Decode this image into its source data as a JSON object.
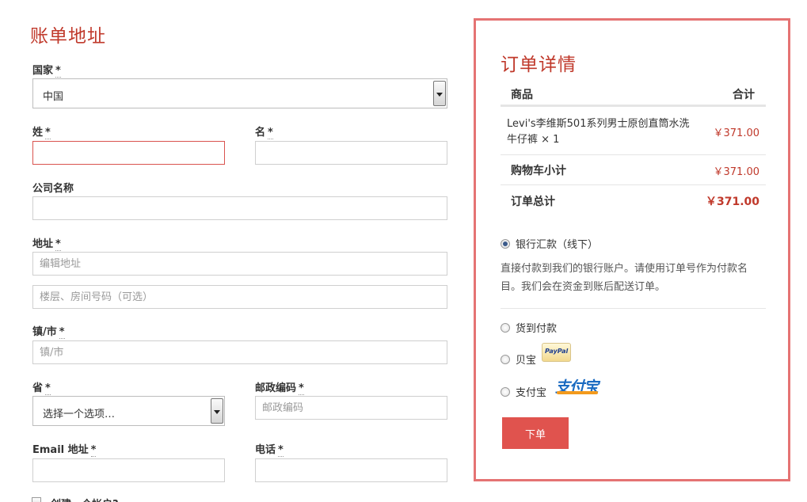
{
  "billing": {
    "title": "账单地址",
    "required_mark": "*",
    "country_label": "国家",
    "country_value": "中国",
    "last_name_label": "姓",
    "first_name_label": "名",
    "company_label": "公司名称",
    "address_label": "地址",
    "address_placeholder": "编辑地址",
    "address2_placeholder": "楼层、房间号码（可选）",
    "city_label": "镇/市",
    "city_placeholder": "镇/市",
    "state_label": "省",
    "state_value": "选择一个选项…",
    "postcode_label": "邮政编码",
    "postcode_placeholder": "邮政编码",
    "email_label": "Email 地址",
    "phone_label": "电话",
    "create_account_label": "创建一个帐户?"
  },
  "order": {
    "title": "订单详情",
    "col_product": "商品",
    "col_total": "合计",
    "item_name": "Levi's李维斯501系列男士原创直筒水洗牛仔裤 × 1",
    "item_price": "￥371.00",
    "subtotal_label": "购物车小计",
    "subtotal_value": "￥371.00",
    "total_label": "订单总计",
    "total_value": "￥371.00",
    "payment_methods": [
      {
        "label": "银行汇款（线下）",
        "selected": true
      },
      {
        "label": "货到付款",
        "selected": false
      },
      {
        "label": "贝宝",
        "selected": false
      },
      {
        "label": "支付宝",
        "selected": false
      }
    ],
    "bank_description": "直接付款到我们的银行账户。请使用订单号作为付款名目。我们会在资金到账后配送订单。",
    "paypal_logo_text": "PayPal",
    "alipay_logo_text": "支付宝",
    "place_order_label": "下单"
  },
  "colors": {
    "accent_red": "#c0392b",
    "button_red": "#e0534e",
    "panel_border": "#e57373"
  }
}
